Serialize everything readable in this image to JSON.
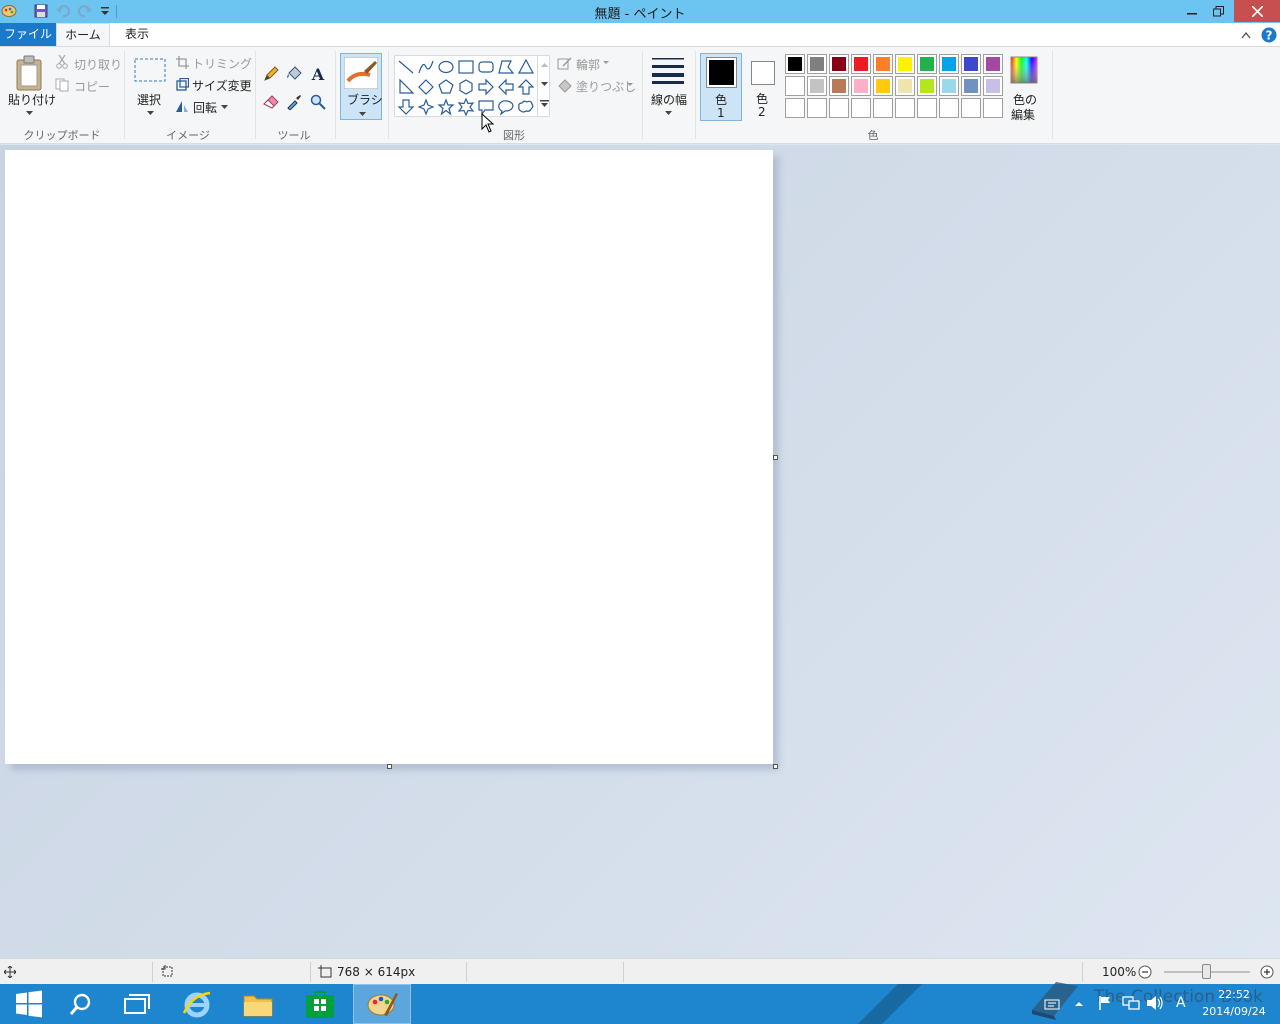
{
  "window": {
    "title": "無題 - ペイント"
  },
  "tabs": {
    "file": "ファイル",
    "home": "ホーム",
    "view": "表示"
  },
  "clipboard": {
    "paste": "貼り付け",
    "cut": "切り取り",
    "copy": "コピー",
    "group": "クリップボード"
  },
  "image": {
    "select": "選択",
    "crop": "トリミング",
    "resize": "サイズ変更",
    "rotate": "回転",
    "group": "イメージ"
  },
  "tools": {
    "group": "ツール",
    "text_glyph": "A"
  },
  "brushes": {
    "label": "ブラシ"
  },
  "shapes": {
    "outline": "輪郭",
    "fill": "塗りつぶし",
    "group": "図形"
  },
  "size": {
    "label": "線の幅"
  },
  "colors": {
    "color1_label": "色",
    "color1_num": "1",
    "color2_label": "色",
    "color2_num": "2",
    "edit_label_1": "色の",
    "edit_label_2": "編集",
    "group": "色",
    "color1_value": "#000000",
    "color2_value": "#ffffff",
    "palette_row1": [
      "#000000",
      "#7f7f7f",
      "#880015",
      "#ed1c24",
      "#ff7f27",
      "#fff200",
      "#22b14c",
      "#00a2e8",
      "#3f48cc",
      "#a349a4"
    ],
    "palette_row2": [
      "#ffffff",
      "#c3c3c3",
      "#b97a57",
      "#ffaec9",
      "#ffc90e",
      "#efe4b0",
      "#b5e61d",
      "#99d9ea",
      "#7092be",
      "#c8bfe7"
    ],
    "palette_row3": [
      "#ffffff",
      "#ffffff",
      "#ffffff",
      "#ffffff",
      "#ffffff",
      "#ffffff",
      "#ffffff",
      "#ffffff",
      "#ffffff",
      "#ffffff"
    ]
  },
  "status": {
    "dimensions": "768 × 614px",
    "zoom": "100%"
  },
  "taskbar": {
    "time": "22:52",
    "date": "2014/09/24",
    "ime": "A",
    "watermark": "The Collection Book"
  }
}
